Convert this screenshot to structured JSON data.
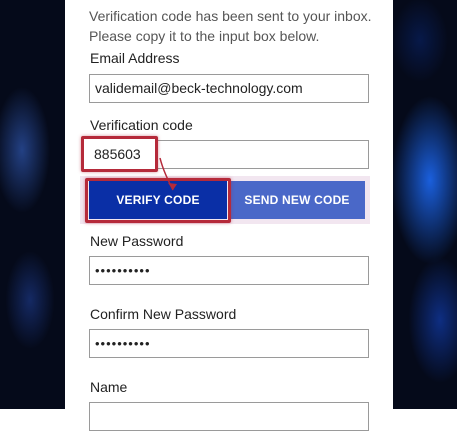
{
  "form": {
    "intro_line1": "Verification code has been sent to your inbox.",
    "intro_line2": "Please copy it to the input box below.",
    "email_label": "Email Address",
    "email_value": "validemail@beck-technology.com",
    "code_label": "Verification code",
    "code_value": "885603",
    "verify_button": "VERIFY CODE",
    "send_new_button": "SEND NEW CODE",
    "new_password_label": "New Password",
    "new_password_value": "••••••••••",
    "confirm_password_label": "Confirm New Password",
    "confirm_password_value": "••••••••••",
    "name_label": "Name"
  },
  "colors": {
    "verify_button": "#0a2fa6",
    "send_button": "#4a68c8",
    "highlight": "#b52a3a"
  }
}
